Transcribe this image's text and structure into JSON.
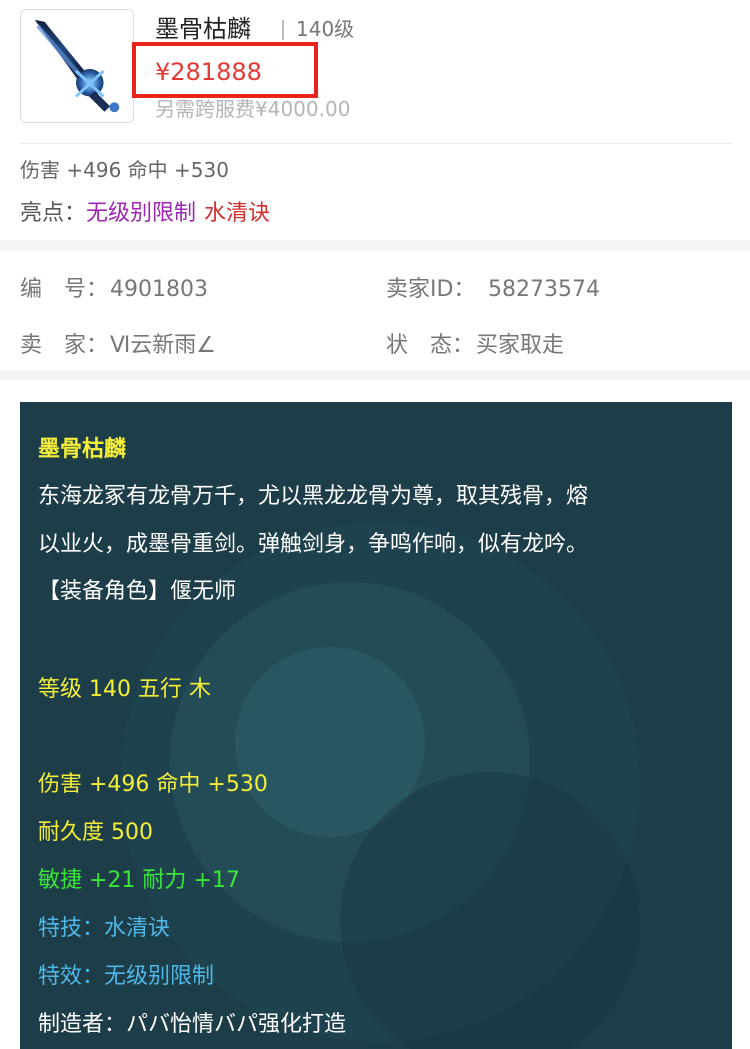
{
  "header": {
    "name": "墨骨枯麟",
    "level": "140级",
    "price": "¥281888",
    "fee": "另需跨服费¥4000.00"
  },
  "stats_line": "伤害 +496 命中 +530",
  "highlights": {
    "label": "亮点：",
    "tag1": "无级别限制",
    "tag2": "水清诀"
  },
  "info": {
    "id_label": "编　号：",
    "id_value": "4901803",
    "seller_id_label": "卖家ID：",
    "seller_id_value": "58273574",
    "seller_label": "卖　家：",
    "seller_value": "Ⅵ云新雨∠",
    "status_label": "状　态：",
    "status_value": "买家取走"
  },
  "description": {
    "title": "墨骨枯麟",
    "lore_1": "东海龙冢有龙骨万千，尤以黑龙龙骨为尊，取其残骨，熔",
    "lore_2": "以业火，成墨骨重剑。弹触剑身，争鸣作响，似有龙吟。",
    "role": "【装备角色】偃无师",
    "level_elem": "等级 140 五行 木",
    "damage": "伤害 +496 命中 +530",
    "durability": "耐久度 500",
    "agility": "敏捷 +21 耐力 +17",
    "skill": "特技：水清诀",
    "effect": "特效：无级别限制",
    "maker": "制造者：パバ怡情バパ强化打造"
  },
  "colors": {
    "price": "#e53935",
    "price_box": "#e8241c",
    "panel_bg": "#1d3d48",
    "yellow_text": "#f5ee38",
    "green_text": "#39e639",
    "blue_text": "#4fb8e8",
    "purple_tag": "#9c27b0",
    "red_tag": "#d32f2f"
  },
  "icons": {
    "item_thumbnail": "dark-blue-sword-icon"
  }
}
